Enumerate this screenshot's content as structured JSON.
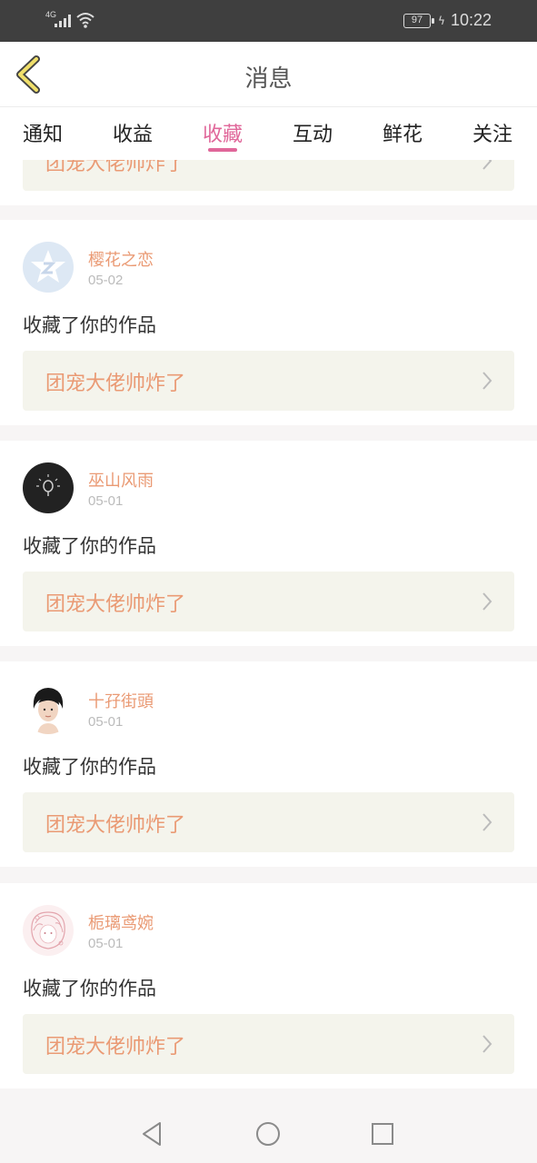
{
  "status_bar": {
    "network": "4G",
    "battery": "97",
    "time": "10:22",
    "icons": [
      "signal-icon",
      "wifi-icon",
      "battery-icon",
      "charging-icon"
    ]
  },
  "header": {
    "title": "消息",
    "back_icon": "chevron-left-icon"
  },
  "tabs": {
    "items": [
      "通知",
      "收益",
      "收藏",
      "互动",
      "鲜花",
      "关注"
    ],
    "active": "收藏",
    "accent_color": "#e0679a"
  },
  "feed": {
    "partial_top": {
      "work_title": "团宠大佬帅炸了"
    },
    "items": [
      {
        "user": "樱花之恋",
        "date": "05-02",
        "action": "收藏了你的作品",
        "work_title": "团宠大佬帅炸了",
        "avatar_icon": "star-avatar-icon"
      },
      {
        "user": "巫山风雨",
        "date": "05-01",
        "action": "收藏了你的作品",
        "work_title": "团宠大佬帅炸了",
        "avatar_icon": "lightbulb-avatar-icon"
      },
      {
        "user": "十孖街頭",
        "date": "05-01",
        "action": "收藏了你的作品",
        "work_title": "团宠大佬帅炸了",
        "avatar_icon": "person-avatar-icon"
      },
      {
        "user": "栀璃鸢婉",
        "date": "05-01",
        "action": "收藏了你的作品",
        "work_title": "团宠大佬帅炸了",
        "avatar_icon": "sketch-avatar-icon"
      }
    ],
    "name_color": "#ea9a74",
    "link_bg": "#f4f4ec"
  },
  "navbar": {
    "icons": [
      "back-triangle-icon",
      "home-circle-icon",
      "recents-square-icon"
    ]
  }
}
